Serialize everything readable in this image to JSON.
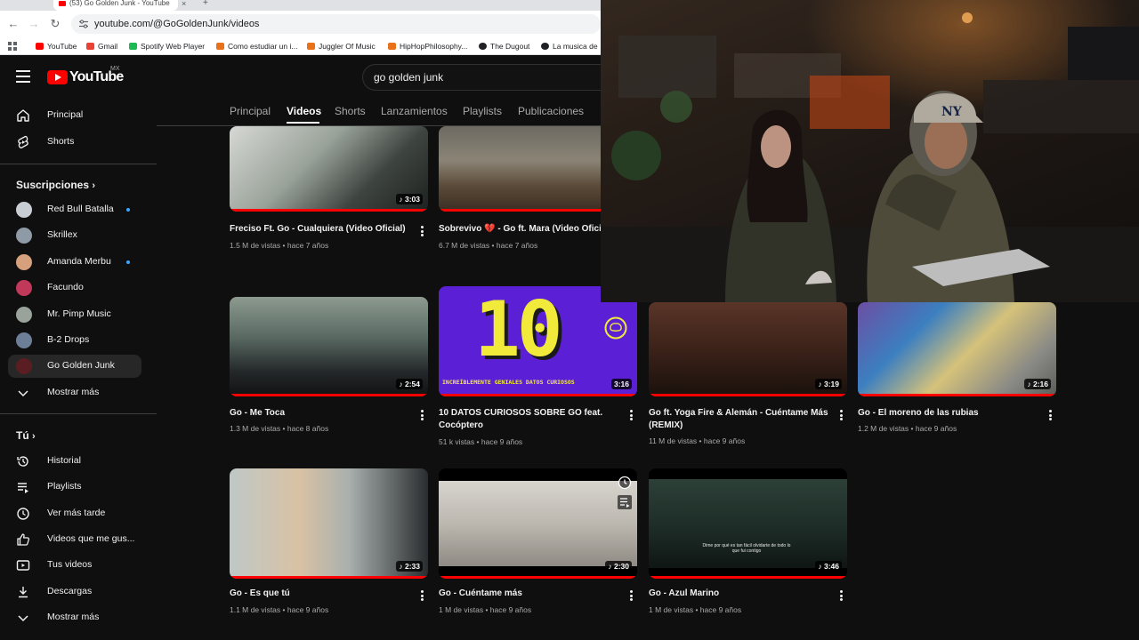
{
  "browser": {
    "tab_title": "(53) Go Golden Junk - YouTube",
    "url": "youtube.com/@GoGoldenJunk/videos",
    "bookmarks": [
      {
        "label": "YouTube",
        "color": "#ff0000"
      },
      {
        "label": "Gmail",
        "color": "#ea4335"
      },
      {
        "label": "Spotify Web Player",
        "color": "#1db954"
      },
      {
        "label": "Como estudiar un i...",
        "color": "#e8711a"
      },
      {
        "label": "Juggler Of Music",
        "color": "#e8711a"
      },
      {
        "label": "HipHopPhilosophy...",
        "color": "#e8711a"
      },
      {
        "label": "The Dugout",
        "color": "#202124"
      },
      {
        "label": "La musica de",
        "color": "#202124"
      }
    ]
  },
  "youtube": {
    "logo_text": "YouTube",
    "country_code": "MX",
    "search_query": "go golden junk",
    "sidebar": {
      "main": [
        {
          "label": "Principal",
          "icon": "home-icon"
        },
        {
          "label": "Shorts",
          "icon": "shorts-icon"
        }
      ],
      "subscriptions_header": "Suscripciones",
      "subscriptions": [
        {
          "label": "Red Bull Batalla",
          "color": "#c9cdd4",
          "dot": true
        },
        {
          "label": "Skrillex",
          "color": "#8e9aa5",
          "dot": false
        },
        {
          "label": "Amanda Merbu",
          "color": "#d7a07c",
          "dot": true
        },
        {
          "label": "Facundo",
          "color": "#c2385a",
          "dot": false
        },
        {
          "label": "Mr. Pimp Music",
          "color": "#9aa39b",
          "dot": false
        },
        {
          "label": "B-2 Drops",
          "color": "#6d7f96",
          "dot": false
        },
        {
          "label": "Go Golden Junk",
          "color": "#5a1e22",
          "dot": false,
          "active": true
        }
      ],
      "show_more_1": "Mostrar más",
      "you_header": "Tú",
      "you": [
        {
          "label": "Historial",
          "icon": "history-icon"
        },
        {
          "label": "Playlists",
          "icon": "playlists-icon"
        },
        {
          "label": "Ver más tarde",
          "icon": "watch-later-icon"
        },
        {
          "label": "Videos que me gus...",
          "icon": "liked-videos-icon"
        },
        {
          "label": "Tus videos",
          "icon": "your-videos-icon"
        },
        {
          "label": "Descargas",
          "icon": "downloads-icon"
        }
      ],
      "show_more_2": "Mostrar más"
    },
    "channel_tabs": [
      "Principal",
      "Videos",
      "Shorts",
      "Lanzamientos",
      "Playlists",
      "Publicaciones"
    ],
    "active_tab": "Videos",
    "videos": [
      {
        "title": "Freciso Ft. Go - Cualquiera (Video Oficial)",
        "views": "1.5 M de vistas",
        "age": "hace 7 años",
        "duration": "3:03",
        "thumb": "linear-gradient(135deg,#d6d8d4 0%,#9aa39a 40%,#3e4440 70%,#1d211f 100%)"
      },
      {
        "title": "Sobrevivo 💔 - Go ft. Mara (Video Oficial)",
        "views": "6.7 M de vistas",
        "age": "hace 7 años",
        "duration": "",
        "thumb": "linear-gradient(180deg,#6d6a62 0%,#8b8476 40%,#5b4a38 70%,#3a2d22 100%)"
      },
      {
        "title": "Go - Me Toca",
        "views": "1.3 M de vistas",
        "age": "hace 8 años",
        "duration": "2:54",
        "thumb": "linear-gradient(180deg,#8c9a8f 0%,#5a6a63 40%,#24282a 75%,#111 100%)"
      },
      {
        "title": "10 DATOS CURIOSOS SOBRE GO feat. Cocóptero",
        "views": "51 k vistas",
        "age": "hace 9 años",
        "duration": "3:16",
        "thumb": "#5b20d6",
        "big_text": "10",
        "caption": "INCREÍBLEMENTE GENIALES DATOS CURIOSOS"
      },
      {
        "title": "Go ft. Yoga Fire & Alemán - Cuéntame Más (REMIX)",
        "views": "11 M de vistas",
        "age": "hace 9 años",
        "duration": "3:19",
        "thumb": "linear-gradient(180deg,#5a3528 0%,#3b2219 50%,#1a100c 100%)"
      },
      {
        "title": "Go - El moreno de las rubias",
        "views": "1.2 M de vistas",
        "age": "hace 9 años",
        "duration": "2:16",
        "thumb": "linear-gradient(135deg,#6c4ea3 0%,#3c7fc0 30%,#d5c27a 55%,#8a8a86 80%,#5b5b58 100%)"
      },
      {
        "title": "Go - Es que tú",
        "views": "1.1 M de vistas",
        "age": "hace 9 años",
        "duration": "2:33",
        "thumb": "linear-gradient(90deg,#bfc8c7 0%,#d9c2a4 35%,#a9b0ae 60%,#2a2d2f 100%)"
      },
      {
        "title": "Go - Cuéntame más",
        "views": "1 M de vistas",
        "age": "hace 9 años",
        "duration": "2:30",
        "thumb": "linear-gradient(180deg,#d7d4ce 0%,#bcb8b0 50%,#8f8a83 100%)"
      },
      {
        "title": "Go - Azul Marino",
        "views": "1 M de vistas",
        "age": "hace 9 años",
        "duration": "3:46",
        "thumb": "linear-gradient(180deg,#2c4038 0%,#1c2a25 60%,#0f1614 100%)",
        "subtitle": "Dime por qué es tan fácil olvidarte de todo lo que fui contigo"
      }
    ]
  }
}
